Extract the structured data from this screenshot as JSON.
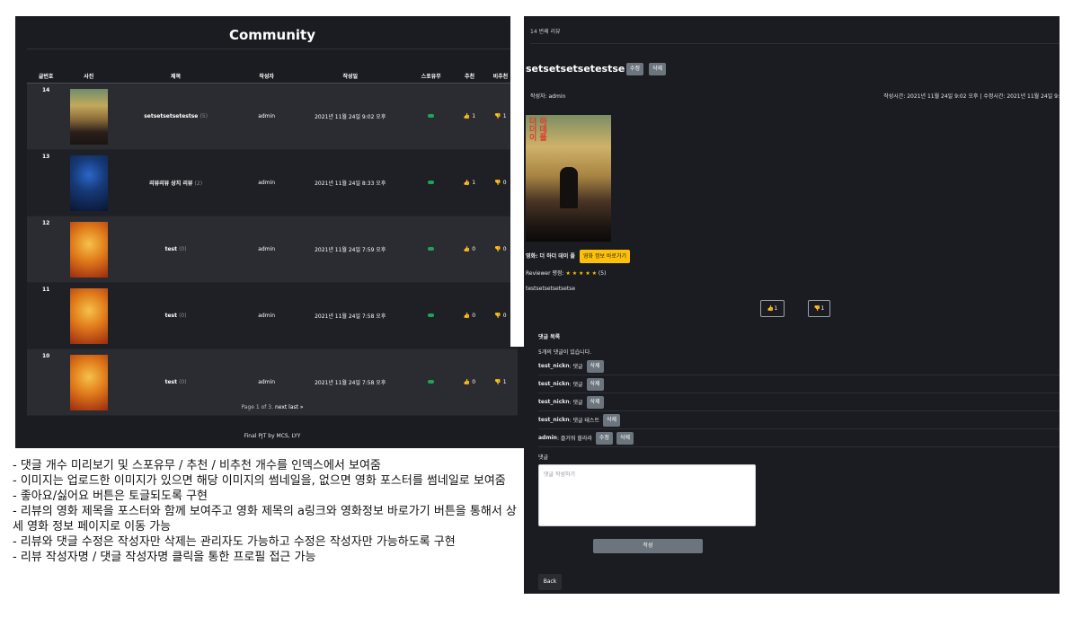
{
  "community": {
    "title": "Community",
    "headers": {
      "num": "글번호",
      "photo": "사진",
      "title": "제목",
      "author": "작성자",
      "date": "작성일",
      "spoiler": "스포유무",
      "like": "추천",
      "dislike": "비추천"
    },
    "rows": [
      {
        "num": "14",
        "title": "setsetsetsetestse",
        "comments": "(5)",
        "author": "admin",
        "date": "2021년 11월 24일 9:02 오후",
        "likes": "1",
        "dislikes": "1"
      },
      {
        "num": "13",
        "title": "리뷰리뷰 상치 리뷰",
        "comments": "(2)",
        "author": "admin",
        "date": "2021년 11월 24일 8:33 오후",
        "likes": "1",
        "dislikes": "0"
      },
      {
        "num": "12",
        "title": "test",
        "comments": "(0)",
        "author": "admin",
        "date": "2021년 11월 24일 7:59 오후",
        "likes": "0",
        "dislikes": "0"
      },
      {
        "num": "11",
        "title": "test",
        "comments": "(0)",
        "author": "admin",
        "date": "2021년 11월 24일 7:58 오후",
        "likes": "0",
        "dislikes": "0"
      },
      {
        "num": "10",
        "title": "test",
        "comments": "(0)",
        "author": "admin",
        "date": "2021년 11월 24일 7:58 오후",
        "likes": "0",
        "dislikes": "1"
      }
    ],
    "pagination": {
      "text": "Page 1 of 3.",
      "next": "next",
      "last": "last »"
    },
    "footer": "Final PJT by MCS, LYY"
  },
  "notes": [
    "- 댓글 개수 미리보기 및 스포유무 / 추천 / 비추천 개수를 인덱스에서 보여줌",
    "- 이미지는 업로드한 이미지가 있으면 해당 이미지의 썸네일을, 없으면 영화 포스터를 썸네일로 보여줌",
    "- 좋아요/싫어요 버튼은 토글되도록 구현",
    "- 리뷰의 영화 제목을 포스터와 함께 보여주고 영화 제목의 a링크와 영화정보 바로가기 버튼을 통해서 상세 영화 정보 페이지로 이동 가능",
    "-   리뷰와 댓글 수정은 작성자만 삭제는 관리자도 가능하고 수정은 작성자만 가능하도록 구현",
    "-   리뷰 작성자명 / 댓글 작성자명 클릭을 통한 프로필 접근 가능"
  ],
  "detail": {
    "breadcrumb": "14 번째 리뷰",
    "title": "setsetsetsetestse",
    "edit_label": "수정",
    "delete_label": "삭제",
    "author_line": "작성자: admin",
    "times_line": "작성시간: 2021년 11월 24일 9:02 오후    |    수정시간: 2021년 11월 24일 9:",
    "poster_title": "더 하더 데이 폴",
    "movie_label": "영화: 더 하더 데이 폴",
    "movie_info_button": "영화 정보 바로가기",
    "score_label": "Reviewer 평점:",
    "stars": "★ ★ ★ ★ ★",
    "score_value": "(5)",
    "content": "testsetsetsetsetse",
    "like_count": "1",
    "dislike_count": "1",
    "comments_title": "댓글 목록",
    "comments_count": "5개의 댓글이 있습니다.",
    "comments": [
      {
        "author": "test_nickn",
        "text": ": 댓글",
        "edit": "",
        "delete": "삭제"
      },
      {
        "author": "test_nickn",
        "text": ": 댓글",
        "edit": "",
        "delete": "삭제"
      },
      {
        "author": "test_nickn",
        "text": ": 댓글",
        "edit": "",
        "delete": "삭제"
      },
      {
        "author": "test_nickn",
        "text": ": 댓글 테스트",
        "edit": "",
        "delete": "삭제"
      },
      {
        "author": "admin",
        "text": ": 즐거워 할라라",
        "edit": "수정",
        "delete": "삭제"
      }
    ],
    "comment_label": "댓글",
    "comment_placeholder": "댓글 작성하기",
    "submit_label": "작성",
    "back_label": "Back"
  }
}
